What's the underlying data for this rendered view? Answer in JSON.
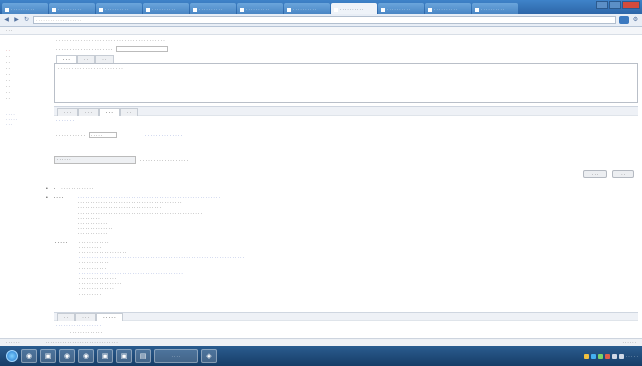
{
  "browser": {
    "tabs": [
      {
        "label": "· · · · · · · · · ·",
        "active": false
      },
      {
        "label": "· · · · · · · · · ·",
        "active": false
      },
      {
        "label": "· · · · · · · · · ·",
        "active": false
      },
      {
        "label": "· · · · · · · · · ·",
        "active": false
      },
      {
        "label": "· · · · · · · · · ·",
        "active": false
      },
      {
        "label": "· · · · · · · · · ·",
        "active": false
      },
      {
        "label": "· · · · · · · · · ·",
        "active": false
      },
      {
        "label": "· · · · · · · · · ·",
        "active": true
      },
      {
        "label": "· · · · · · · · · ·",
        "active": false
      },
      {
        "label": "· · · · · · · · · ·",
        "active": false
      },
      {
        "label": "· · · · · · · · · ·",
        "active": false
      },
      {
        "label": "· · · · · · · · · ·",
        "active": false
      }
    ],
    "url": "· · · · · · · · · · · · · · · · · · ·",
    "bookmark": "· · ·"
  },
  "sidebar": {
    "items": [
      "· ·",
      "· ·",
      "· ·",
      "· ·",
      "· ·",
      "· ·",
      "· ·",
      "· ·",
      "· ·"
    ],
    "links": [
      "· · · ·",
      "· · · · ·",
      "· · ·"
    ]
  },
  "main": {
    "instruction": "· · · · · · · · · · · · · · · · · · · · · · · · · · · · · · · · · · · · · · · ·",
    "field_line": "· · · · · · · · · · · · · · · · · · · · ·",
    "upper_tabs": [
      "· · ·",
      "· ·",
      "· ·"
    ],
    "textarea_text": "· · · · · · · · · · · · · · · · · · · · · · · ·",
    "lower_tabs": [
      "· · ·",
      "· · ·",
      "· · ·",
      "· ·"
    ],
    "section_label": "· · · · · · ·",
    "option_label": "· · · · · · · · · · ·",
    "option_value": "· · · · ·",
    "option_hint": "· · · · · · · · · · · · · ·",
    "search_box": "· · · · · ·",
    "search_result": "· · · · · · · · · · · · · · · · · ·",
    "buttons": [
      "· · ·",
      "· ·"
    ],
    "record_title": "· · · · · · · · · · · · ·",
    "block1_label": "· · · ·",
    "block1_lines": [
      "· · · · · · · · · · · · · · · · · · · · · · · · · · · · · · · · · · · · · · · · · · · · · · · · · · · · · · · ·",
      "· · · · · · · · · · · · · · · · · · · · · · · · · · · · · · · · · · · · · · · · ·",
      "· · · · · · · · · · · · · · · · · · · · · · · · · · · · · · · · ·",
      "· · · · · · · · · · · · · · · · · · · · · · · · · · · · · · · · · · · · · · · · · · · · · · · · ·",
      "· · · · · · · · ·",
      "· · · · · · · · · · · ·",
      "· · · · · · · · · · · · · ·",
      "· · · · · · · · · · · ·"
    ],
    "block2_label": "· · · · ·",
    "block2_lines": [
      "· · · · · · · · · · · ·",
      "· · · · · · · · ·",
      "· · · · · · · · · · · · · · · · · · ·",
      "· · · · · · · · · · · · · · · · · · · · · · · · · · · · · · · · · · · · · · · · · · · · · · · · · · · · · · · · · · · · · · · · ·",
      "· · · · · · · · · · · ·",
      "· · · · · · · · · · ·",
      "· · · · · · · · · · · · · · · · · · · · · · · · · · · · · · · · · · · · · · · · ·",
      "· · · · · · · · · · · · · · ·",
      "· · · · · · · · · · · · · · · · ·",
      "· · · · · · · · · · · · · ·",
      "· · · · · · · · ·"
    ],
    "bottom_tabs": [
      "· ·",
      "· · ·",
      "· · · · ·"
    ],
    "bottom_line1": "· · · · · · · · · · · · · · · · · ·",
    "bottom_line2": "· · · · · · · · · · · · ·"
  },
  "status": {
    "left": "· · · · · ·",
    "middle": "· · · · · · · · · · · · · · · · · · · · · · · · · · · · · ·",
    "right": "· · · · · ·"
  },
  "taskbar": {
    "apps": [
      "◉",
      "▣",
      "◉",
      "◉",
      "▣",
      "▣",
      "▤",
      "◈"
    ],
    "active_app_label": "· · · ·",
    "clock": "· · · · ·"
  },
  "colors": {
    "accent": "#2d66a8",
    "link": "#3555b5",
    "danger": "#b72d2d",
    "taskbar": "#1f4a78"
  }
}
